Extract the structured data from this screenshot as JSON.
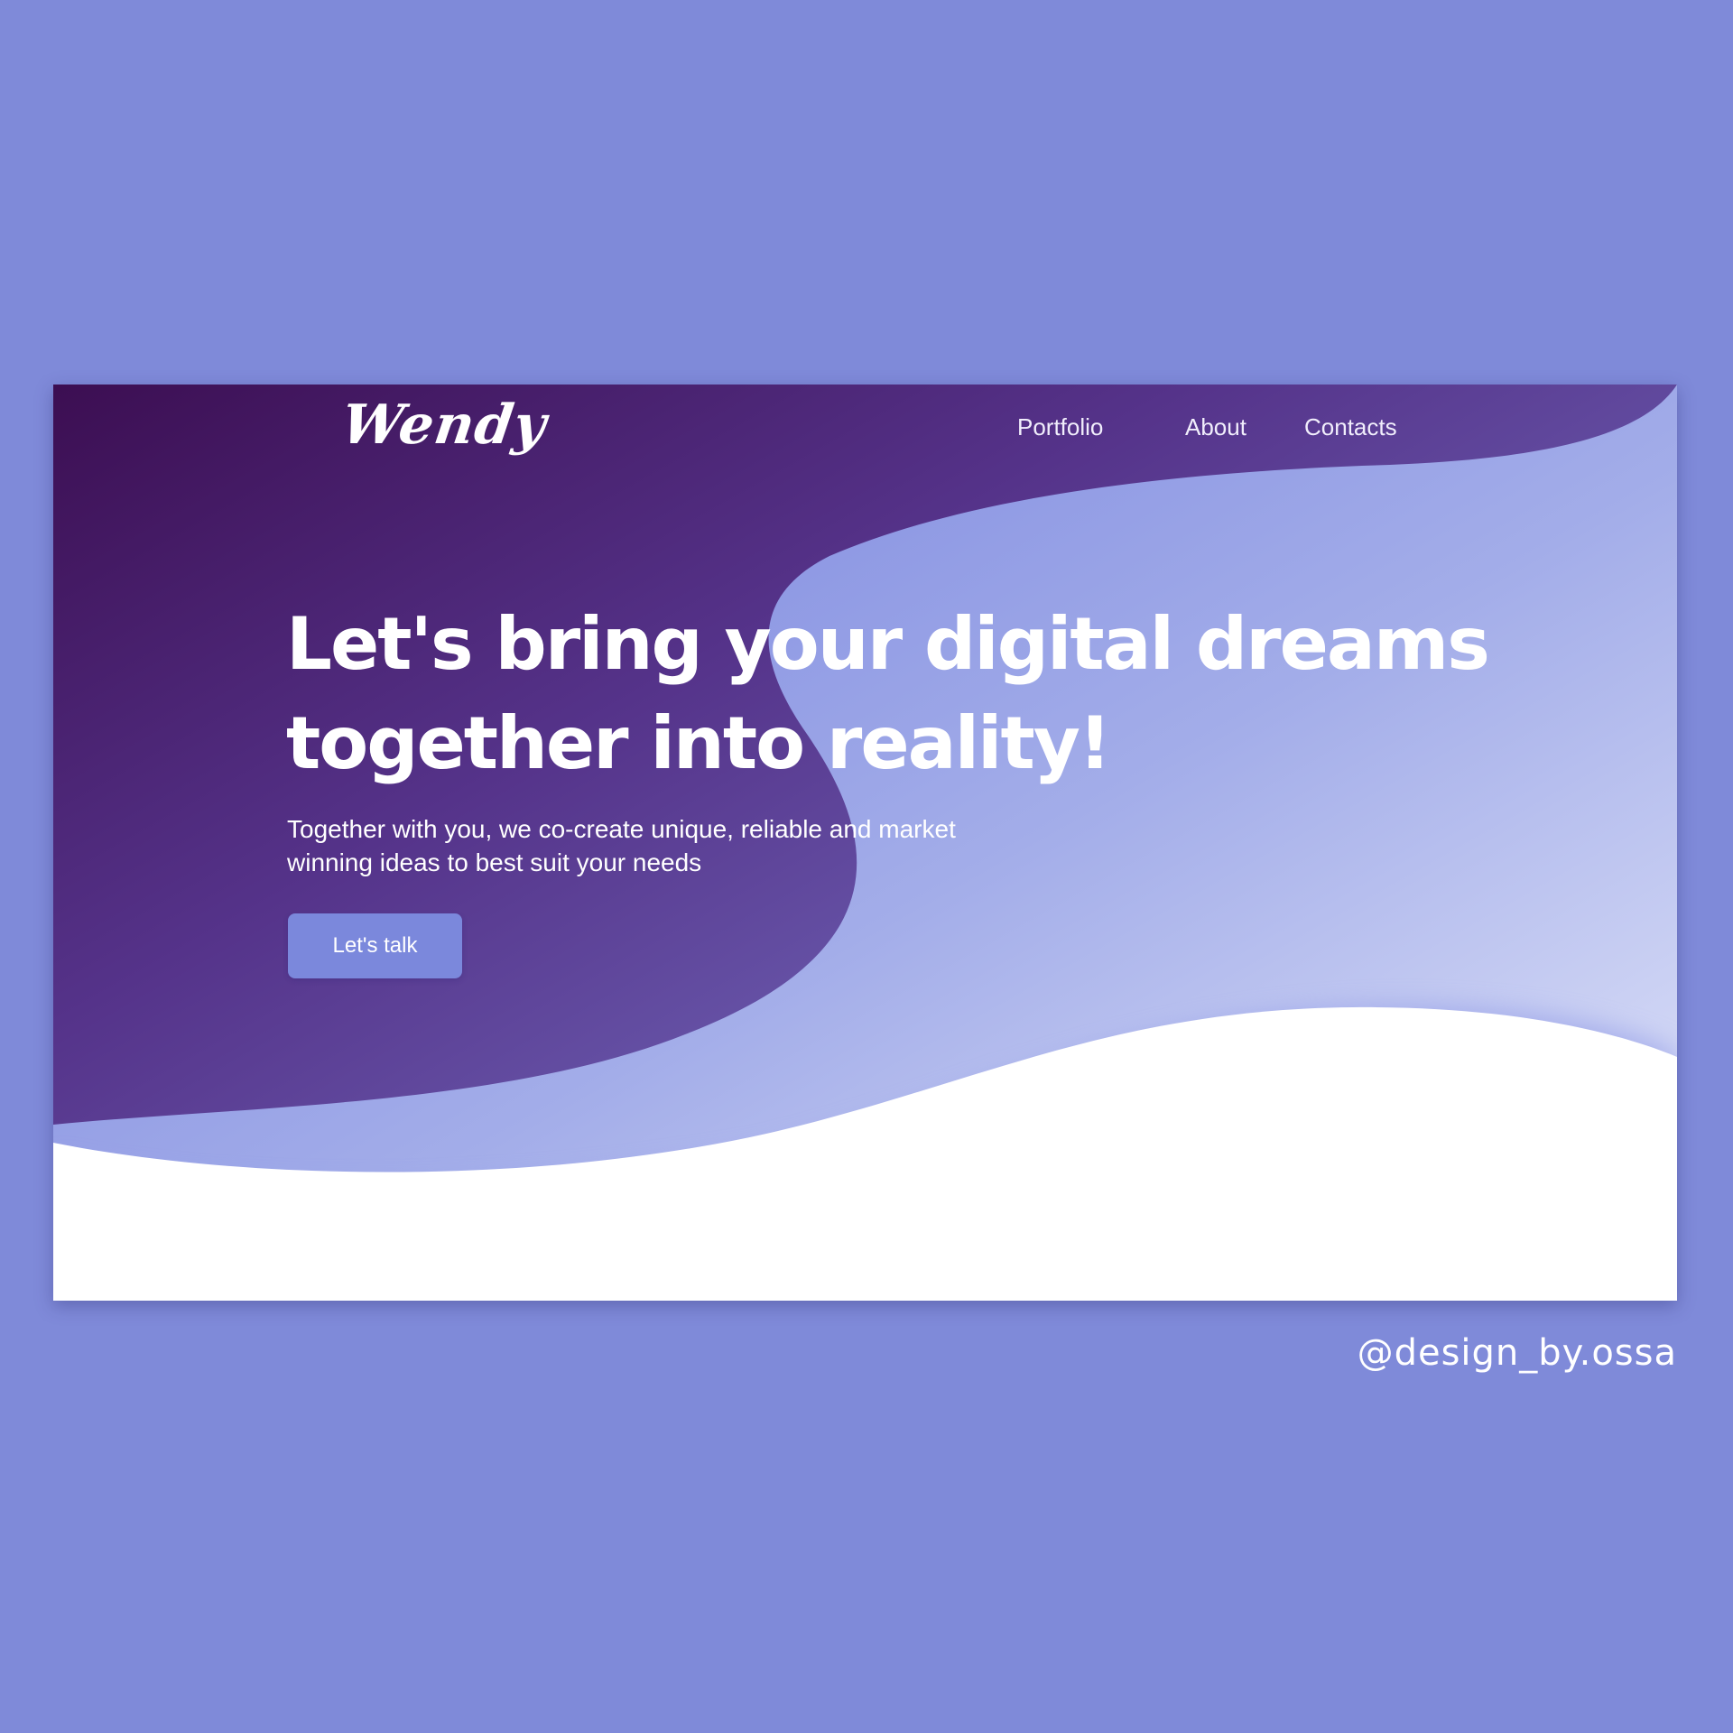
{
  "brand": {
    "logo": "Wendy"
  },
  "nav": {
    "items": [
      {
        "label": "Portfolio"
      },
      {
        "label": "About"
      },
      {
        "label": "Contacts"
      }
    ]
  },
  "hero": {
    "headline_line1": "Let's bring your digital dreams",
    "headline_line2": "together into reality!",
    "subtitle_line1": "Together with you, we co-create unique, reliable and market",
    "subtitle_line2": "winning ideas to best suit your needs",
    "cta_label": "Let's talk"
  },
  "footer": {
    "credit": "@design_by.ossa"
  },
  "colors": {
    "page_background": "#7f8ad9",
    "hero_dark": "#3c0e52",
    "hero_mid": "#6a5db0",
    "hero_light": "#8a95e4",
    "cta_background": "#7b88dc",
    "text": "#ffffff"
  }
}
